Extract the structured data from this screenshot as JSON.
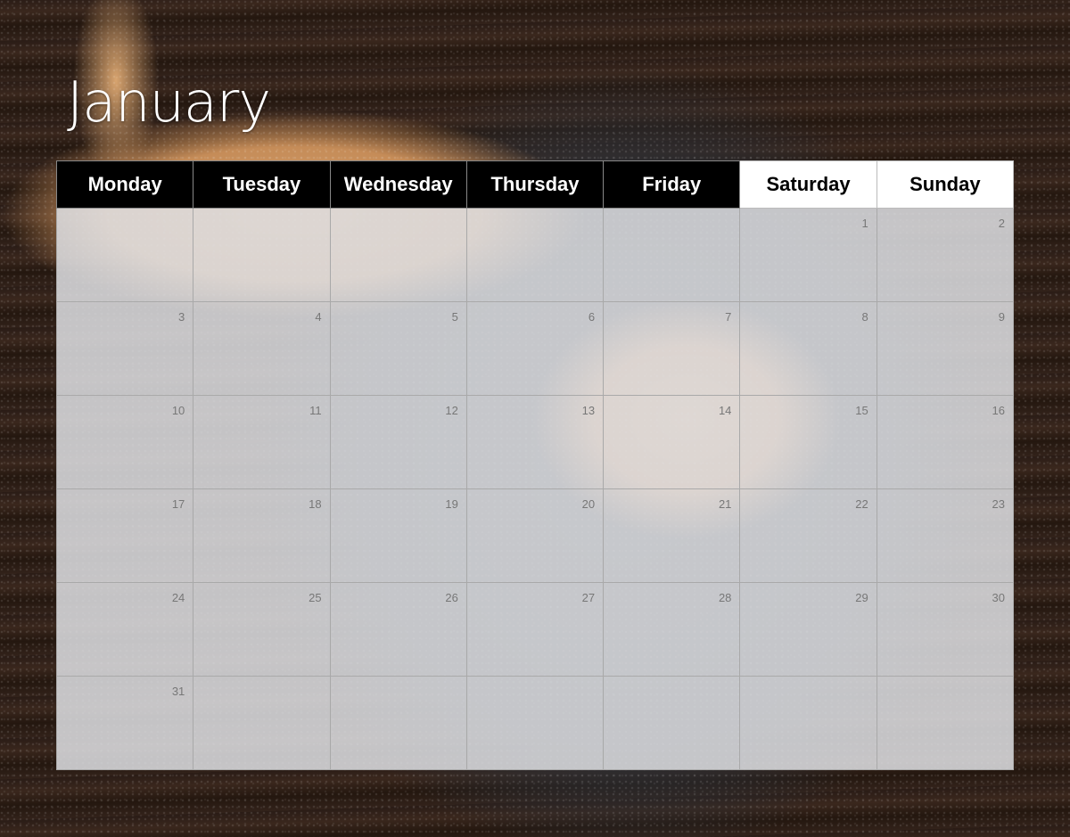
{
  "calendar": {
    "month": "January",
    "weekdays": [
      "Monday",
      "Tuesday",
      "Wednesday",
      "Thursday",
      "Friday",
      "Saturday",
      "Sunday"
    ],
    "weeks": [
      [
        "",
        "",
        "",
        "",
        "",
        "1",
        "2"
      ],
      [
        "3",
        "4",
        "5",
        "6",
        "7",
        "8",
        "9"
      ],
      [
        "10",
        "11",
        "12",
        "13",
        "14",
        "15",
        "16"
      ],
      [
        "17",
        "18",
        "19",
        "20",
        "21",
        "22",
        "23"
      ],
      [
        "24",
        "25",
        "26",
        "27",
        "28",
        "29",
        "30"
      ],
      [
        "31",
        "",
        "",
        "",
        "",
        "",
        ""
      ]
    ]
  },
  "background": {
    "image_subject": "orange tabby kitten lying on dark knitted blanket over wooden floor"
  },
  "colors": {
    "header_weekday_bg": "#000000",
    "header_weekday_text": "#ffffff",
    "header_weekend_bg": "#ffffff",
    "header_weekend_text": "#000000",
    "day_number": "#777777"
  }
}
